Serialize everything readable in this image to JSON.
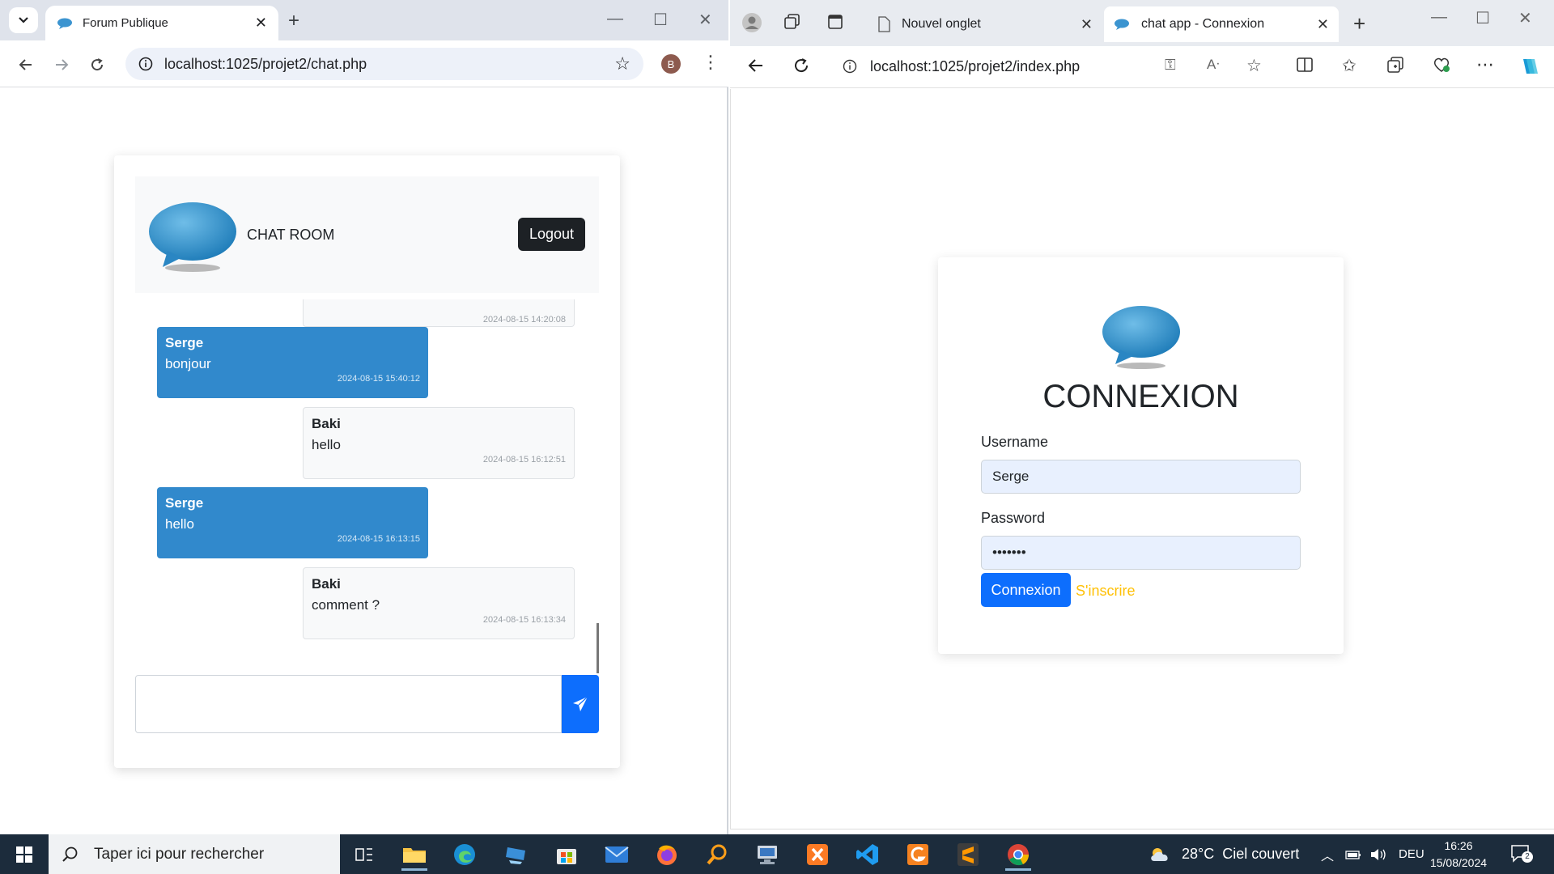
{
  "left_window": {
    "tab_title": "Forum Publique",
    "url": "localhost:1025/projet2/chat.php",
    "profile_initial": "B",
    "chat": {
      "title": "CHAT ROOM",
      "logout_label": "Logout",
      "partial_timestamp": "2024-08-15 14:20:08",
      "messages": [
        {
          "author": "Serge",
          "text": "bonjour",
          "timestamp": "2024-08-15 15:40:12",
          "side": "mine"
        },
        {
          "author": "Baki",
          "text": "hello",
          "timestamp": "2024-08-15 16:12:51",
          "side": "other"
        },
        {
          "author": "Serge",
          "text": "hello",
          "timestamp": "2024-08-15 16:13:15",
          "side": "mine"
        },
        {
          "author": "Baki",
          "text": "comment ?",
          "timestamp": "2024-08-15 16:13:34",
          "side": "other"
        }
      ],
      "input_value": ""
    }
  },
  "right_window": {
    "tabs": [
      {
        "title": "Nouvel onglet",
        "active": false
      },
      {
        "title": "chat app - Connexion",
        "active": true
      }
    ],
    "url": "localhost:1025/projet2/index.php",
    "login": {
      "title": "CONNEXION",
      "username_label": "Username",
      "username_value": "Serge",
      "password_label": "Password",
      "password_value": "•••••••",
      "submit_label": "Connexion",
      "signup_label": "S'inscrire"
    }
  },
  "taskbar": {
    "search_placeholder": "Taper ici pour rechercher",
    "weather_temp": "28°C",
    "weather_desc": "Ciel couvert",
    "language": "DEU",
    "time": "16:26",
    "date": "15/08/2024",
    "notifications": "2"
  },
  "colors": {
    "my_message": "#3189cc",
    "primary": "#0d6efd",
    "signup_link": "#ffc107",
    "taskbar": "#1c2c3c"
  }
}
